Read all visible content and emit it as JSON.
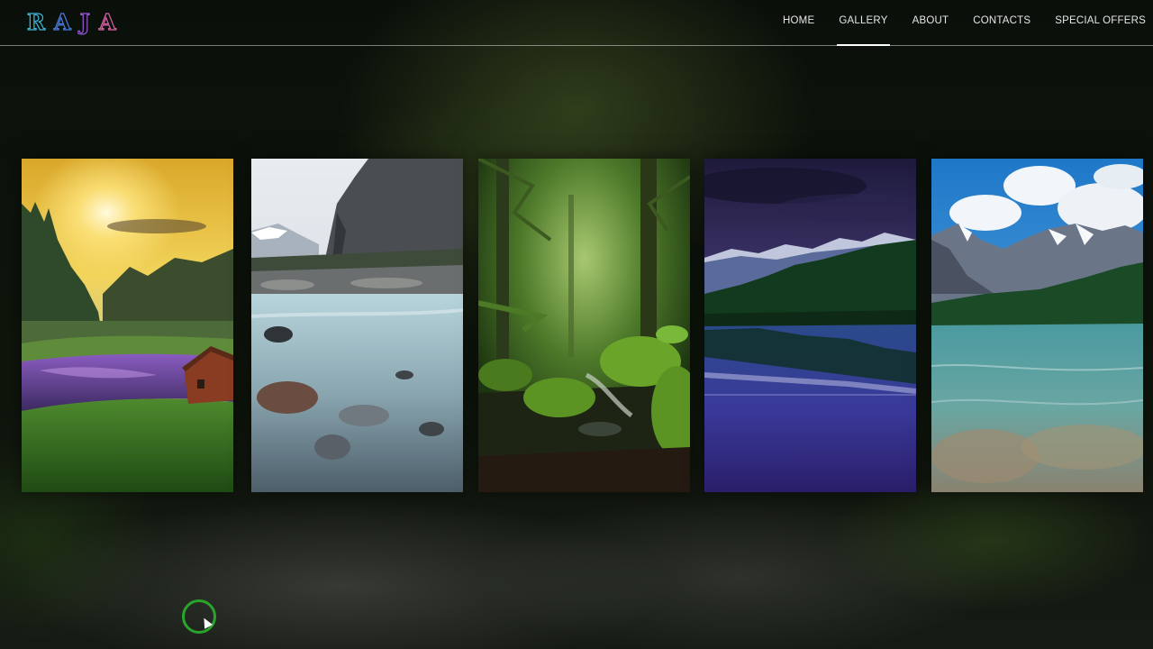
{
  "brand": {
    "letters": [
      "R",
      "A",
      "J",
      "A"
    ],
    "name": "RAJA"
  },
  "nav": {
    "items": [
      {
        "label": "HOME",
        "active": false
      },
      {
        "label": "GALLERY",
        "active": true
      },
      {
        "label": "ABOUT",
        "active": false
      },
      {
        "label": "CONTACTS",
        "active": false
      },
      {
        "label": "SPECIAL OFFERS",
        "active": false
      }
    ]
  },
  "gallery": {
    "cards": [
      {
        "scene": "sunset-meadow-cabin"
      },
      {
        "scene": "mountain-river-rocks"
      },
      {
        "scene": "mossy-forest-stream"
      },
      {
        "scene": "purple-mountain-lake"
      },
      {
        "scene": "alpine-clear-lake"
      }
    ]
  },
  "colors": {
    "logo_gradient": [
      "#3fb8d8",
      "#4a7de0",
      "#9a58d8",
      "#d862a8"
    ],
    "nav_text": "#e6e6e6",
    "cursor_ring": "#2aa52a"
  }
}
